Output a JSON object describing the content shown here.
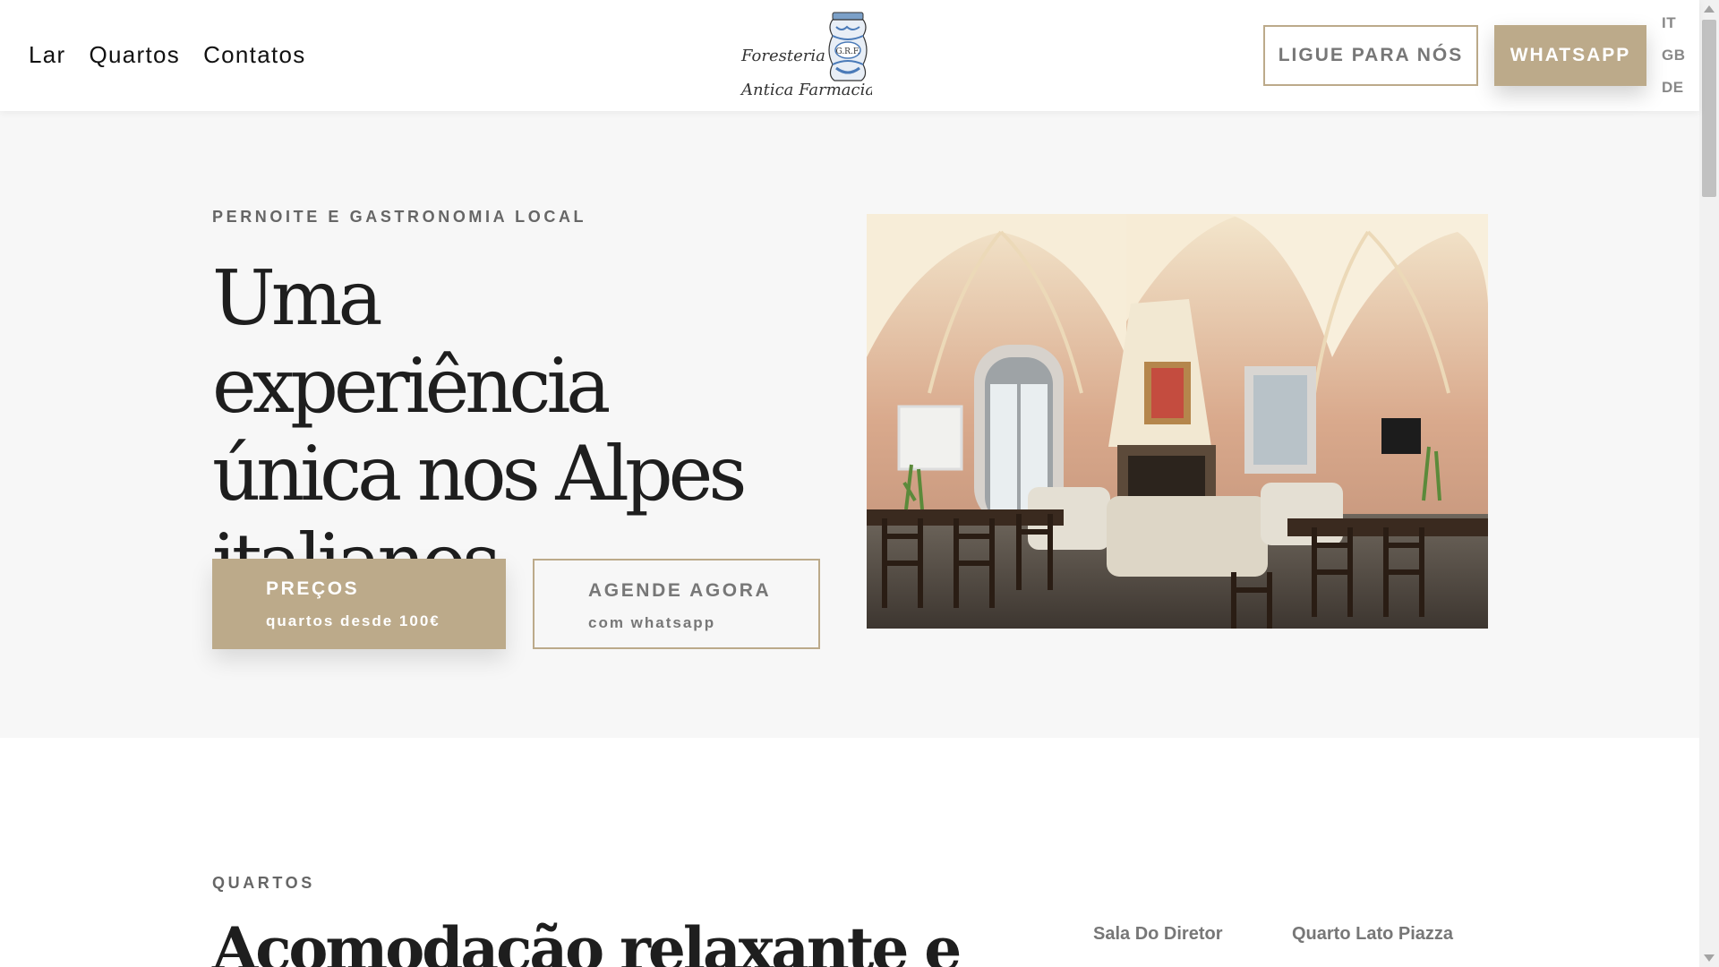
{
  "header": {
    "nav": [
      "Lar",
      "Quartos",
      "Contatos"
    ],
    "logo": {
      "line1": "Foresteria",
      "line2": "Antica Farmacia",
      "jar_initials": "G.R.F.",
      "icon": "apothecary-jar-logo"
    },
    "call_button": "LIGUE PARA NÓS",
    "whatsapp_button": "WHATSAPP",
    "languages": [
      "IT",
      "GB",
      "DE"
    ]
  },
  "hero": {
    "eyebrow": "PERNOITE E GASTRONOMIA LOCAL",
    "title_lines": [
      "Uma experiência",
      "única nos Alpes",
      "italianos"
    ],
    "cta_price": {
      "label": "PREÇOS",
      "sub": "quartos desde 100€"
    },
    "cta_book": {
      "label": "AGENDE AGORA",
      "sub": "com whatsapp"
    },
    "image_alt": "vaulted-living-room-photo"
  },
  "rooms": {
    "eyebrow": "QUARTOS",
    "title": "Acomodacão relaxante e",
    "tabs": [
      "Sala Do Diretor",
      "Quarto Lato Piazza"
    ]
  },
  "colors": {
    "accent": "#bcaa8a",
    "hero_bg": "#f7f7f7",
    "text": "#1e1e1e"
  }
}
